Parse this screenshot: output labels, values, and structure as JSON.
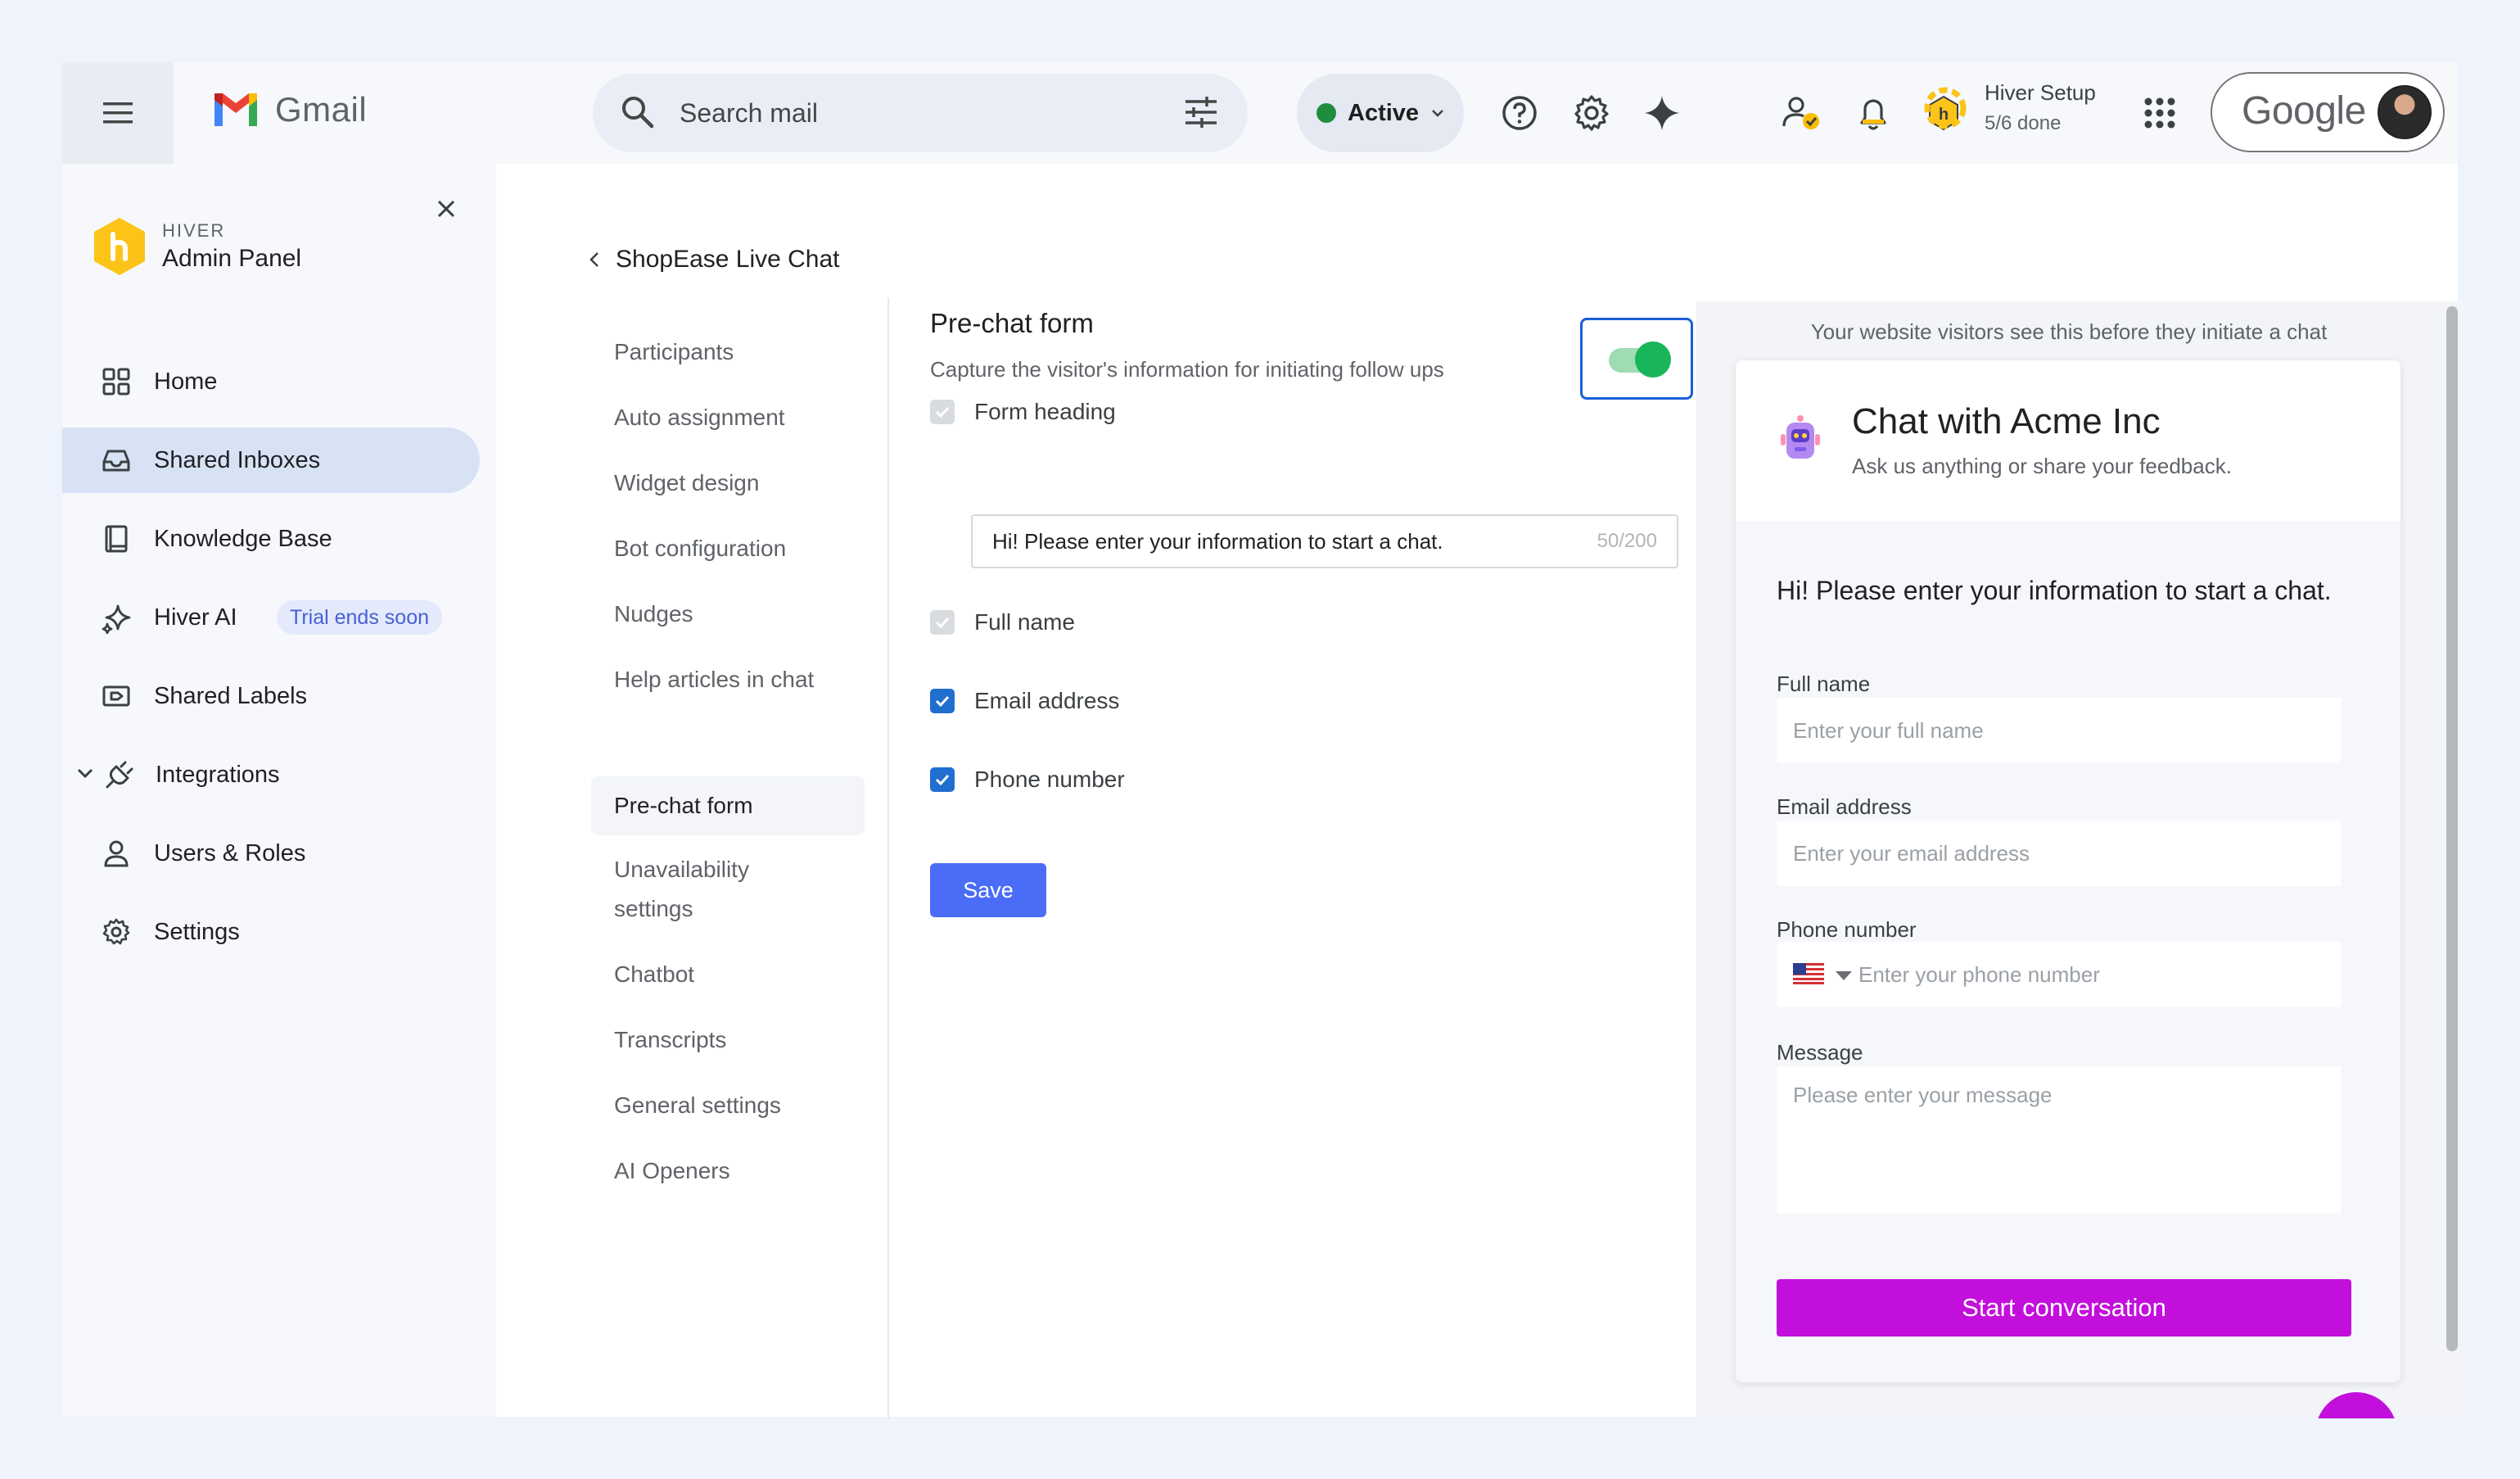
{
  "colors": {
    "page_bg": "#eef3fc",
    "status_active": "#1e8e3e",
    "toggle_on": "#18b55a",
    "checkbox_checked": "#1f6fd0",
    "save_button": "#4a6cf7",
    "start_button": "#c30fdc",
    "trial_badge_text": "#4661d6"
  },
  "topbar": {
    "app_name": "Gmail",
    "search_placeholder": "Search mail",
    "status": "Active",
    "setup_title": "Hiver Setup",
    "setup_progress": "5/6 done",
    "setup_progress_fraction": 0.833,
    "account_label": "Google",
    "icons": [
      "menu-icon",
      "search-icon",
      "tune-icon",
      "help-icon",
      "settings-icon",
      "sparkle-icon",
      "person-check-icon",
      "bell-icon",
      "hiver-badge-icon",
      "apps-grid-icon"
    ]
  },
  "sidebar": {
    "brand": "HIVER",
    "title": "Admin Panel",
    "items": [
      {
        "label": "Home",
        "icon": "grid-icon"
      },
      {
        "label": "Shared Inboxes",
        "icon": "inbox-icon",
        "active": true
      },
      {
        "label": "Knowledge Base",
        "icon": "book-icon"
      },
      {
        "label": "Hiver AI",
        "icon": "ai-sparkle-icon",
        "badge": "Trial ends soon"
      },
      {
        "label": "Shared Labels",
        "icon": "label-icon"
      },
      {
        "label": "Integrations",
        "icon": "plug-icon",
        "expandable": true
      },
      {
        "label": "Users & Roles",
        "icon": "user-icon"
      },
      {
        "label": "Settings",
        "icon": "gear-icon"
      }
    ]
  },
  "subnav": {
    "title": "ShopEase Live Chat",
    "items": [
      "Participants",
      "Auto assignment",
      "Widget design",
      "Bot configuration",
      "Nudges",
      "Help articles in chat",
      "Pre-chat form",
      "Unavailability settings",
      "Chatbot",
      "Transcripts",
      "General settings",
      "AI Openers"
    ],
    "active": "Pre-chat form"
  },
  "form": {
    "title": "Pre-chat form",
    "subtitle": "Capture the visitor's information for initiating follow ups",
    "enabled": true,
    "fields": [
      {
        "label": "Form heading",
        "checked": true,
        "disabled": true
      },
      {
        "label": "Full name",
        "checked": true,
        "disabled": true
      },
      {
        "label": "Email address",
        "checked": true,
        "disabled": false
      },
      {
        "label": "Phone number",
        "checked": true,
        "disabled": false
      }
    ],
    "heading_value": "Hi! Please enter your information to start a chat.",
    "heading_count": "50/200",
    "save_label": "Save"
  },
  "preview": {
    "note": "Your website visitors see this before they initiate a chat",
    "chat_title": "Chat with Acme Inc",
    "chat_subtitle": "Ask us anything or share your feedback.",
    "heading": "Hi! Please enter your information to start a chat.",
    "fullname_label": "Full name",
    "fullname_placeholder": "Enter your full name",
    "email_label": "Email address",
    "email_placeholder": "Enter your email address",
    "phone_label": "Phone number",
    "phone_placeholder": "Enter your phone number",
    "message_label": "Message",
    "message_placeholder": "Please enter your message",
    "start_label": "Start conversation"
  }
}
